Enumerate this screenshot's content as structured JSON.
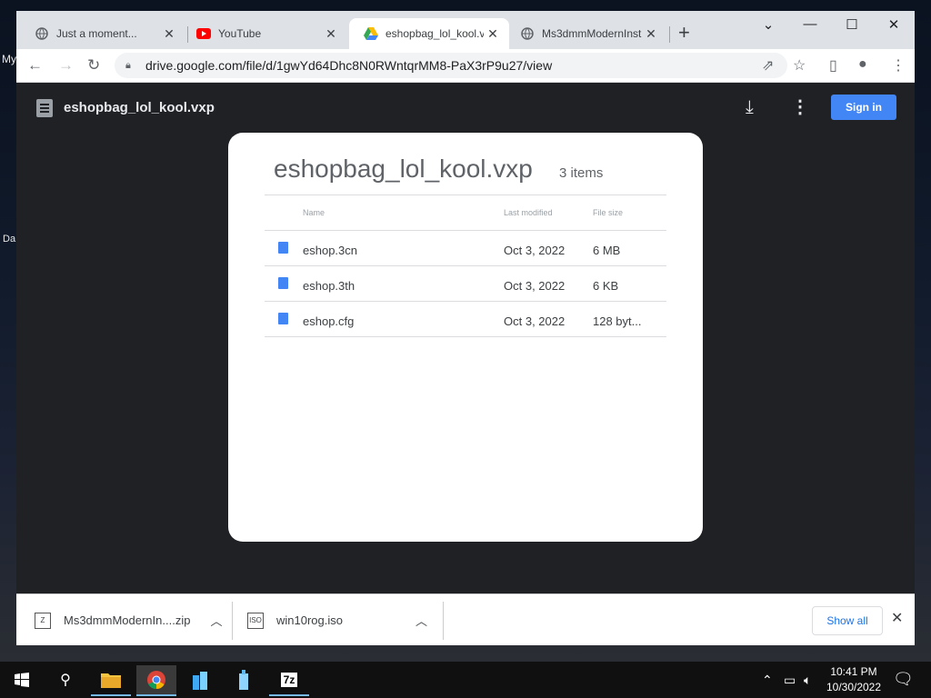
{
  "desktop": {
    "label1": "My",
    "label2": "Da"
  },
  "tabs": [
    {
      "title": "Just a moment...",
      "icon": "globe-icon"
    },
    {
      "title": "YouTube",
      "icon": "youtube-icon"
    },
    {
      "title": "eshopbag_lol_kool.vx",
      "icon": "google-drive-icon"
    },
    {
      "title": "Ms3dmmModernInst",
      "icon": "globe-icon"
    }
  ],
  "address_bar": {
    "url": "drive.google.com/file/d/1gwYd64Dhc8N0RWntqrMM8-PaX3rP9u27/view"
  },
  "viewer": {
    "title": "eshopbag_lol_kool.vxp",
    "signin_label": "Sign in"
  },
  "archive": {
    "title": "eshopbag_lol_kool.vxp",
    "count": "3 items",
    "columns": {
      "name": "Name",
      "modified": "Last modified",
      "size": "File size"
    },
    "files": [
      {
        "name": "eshop.3cn",
        "modified": "Oct 3, 2022",
        "size": "6 MB"
      },
      {
        "name": "eshop.3th",
        "modified": "Oct 3, 2022",
        "size": "6 KB"
      },
      {
        "name": "eshop.cfg",
        "modified": "Oct 3, 2022",
        "size": "128 byt..."
      }
    ]
  },
  "downloads": {
    "items": [
      {
        "name": "Ms3dmmModernIn....zip",
        "icon": "zip-file-icon"
      },
      {
        "name": "win10rog.iso",
        "icon": "iso-file-icon"
      }
    ],
    "show_all": "Show all"
  },
  "taskbar": {
    "time": "10:41 PM",
    "date": "10/30/2022",
    "app_7z": "7z"
  },
  "colors": {
    "accent": "#4285f4",
    "chrome_dark": "#202124",
    "tab_strip": "#dee1e6"
  }
}
